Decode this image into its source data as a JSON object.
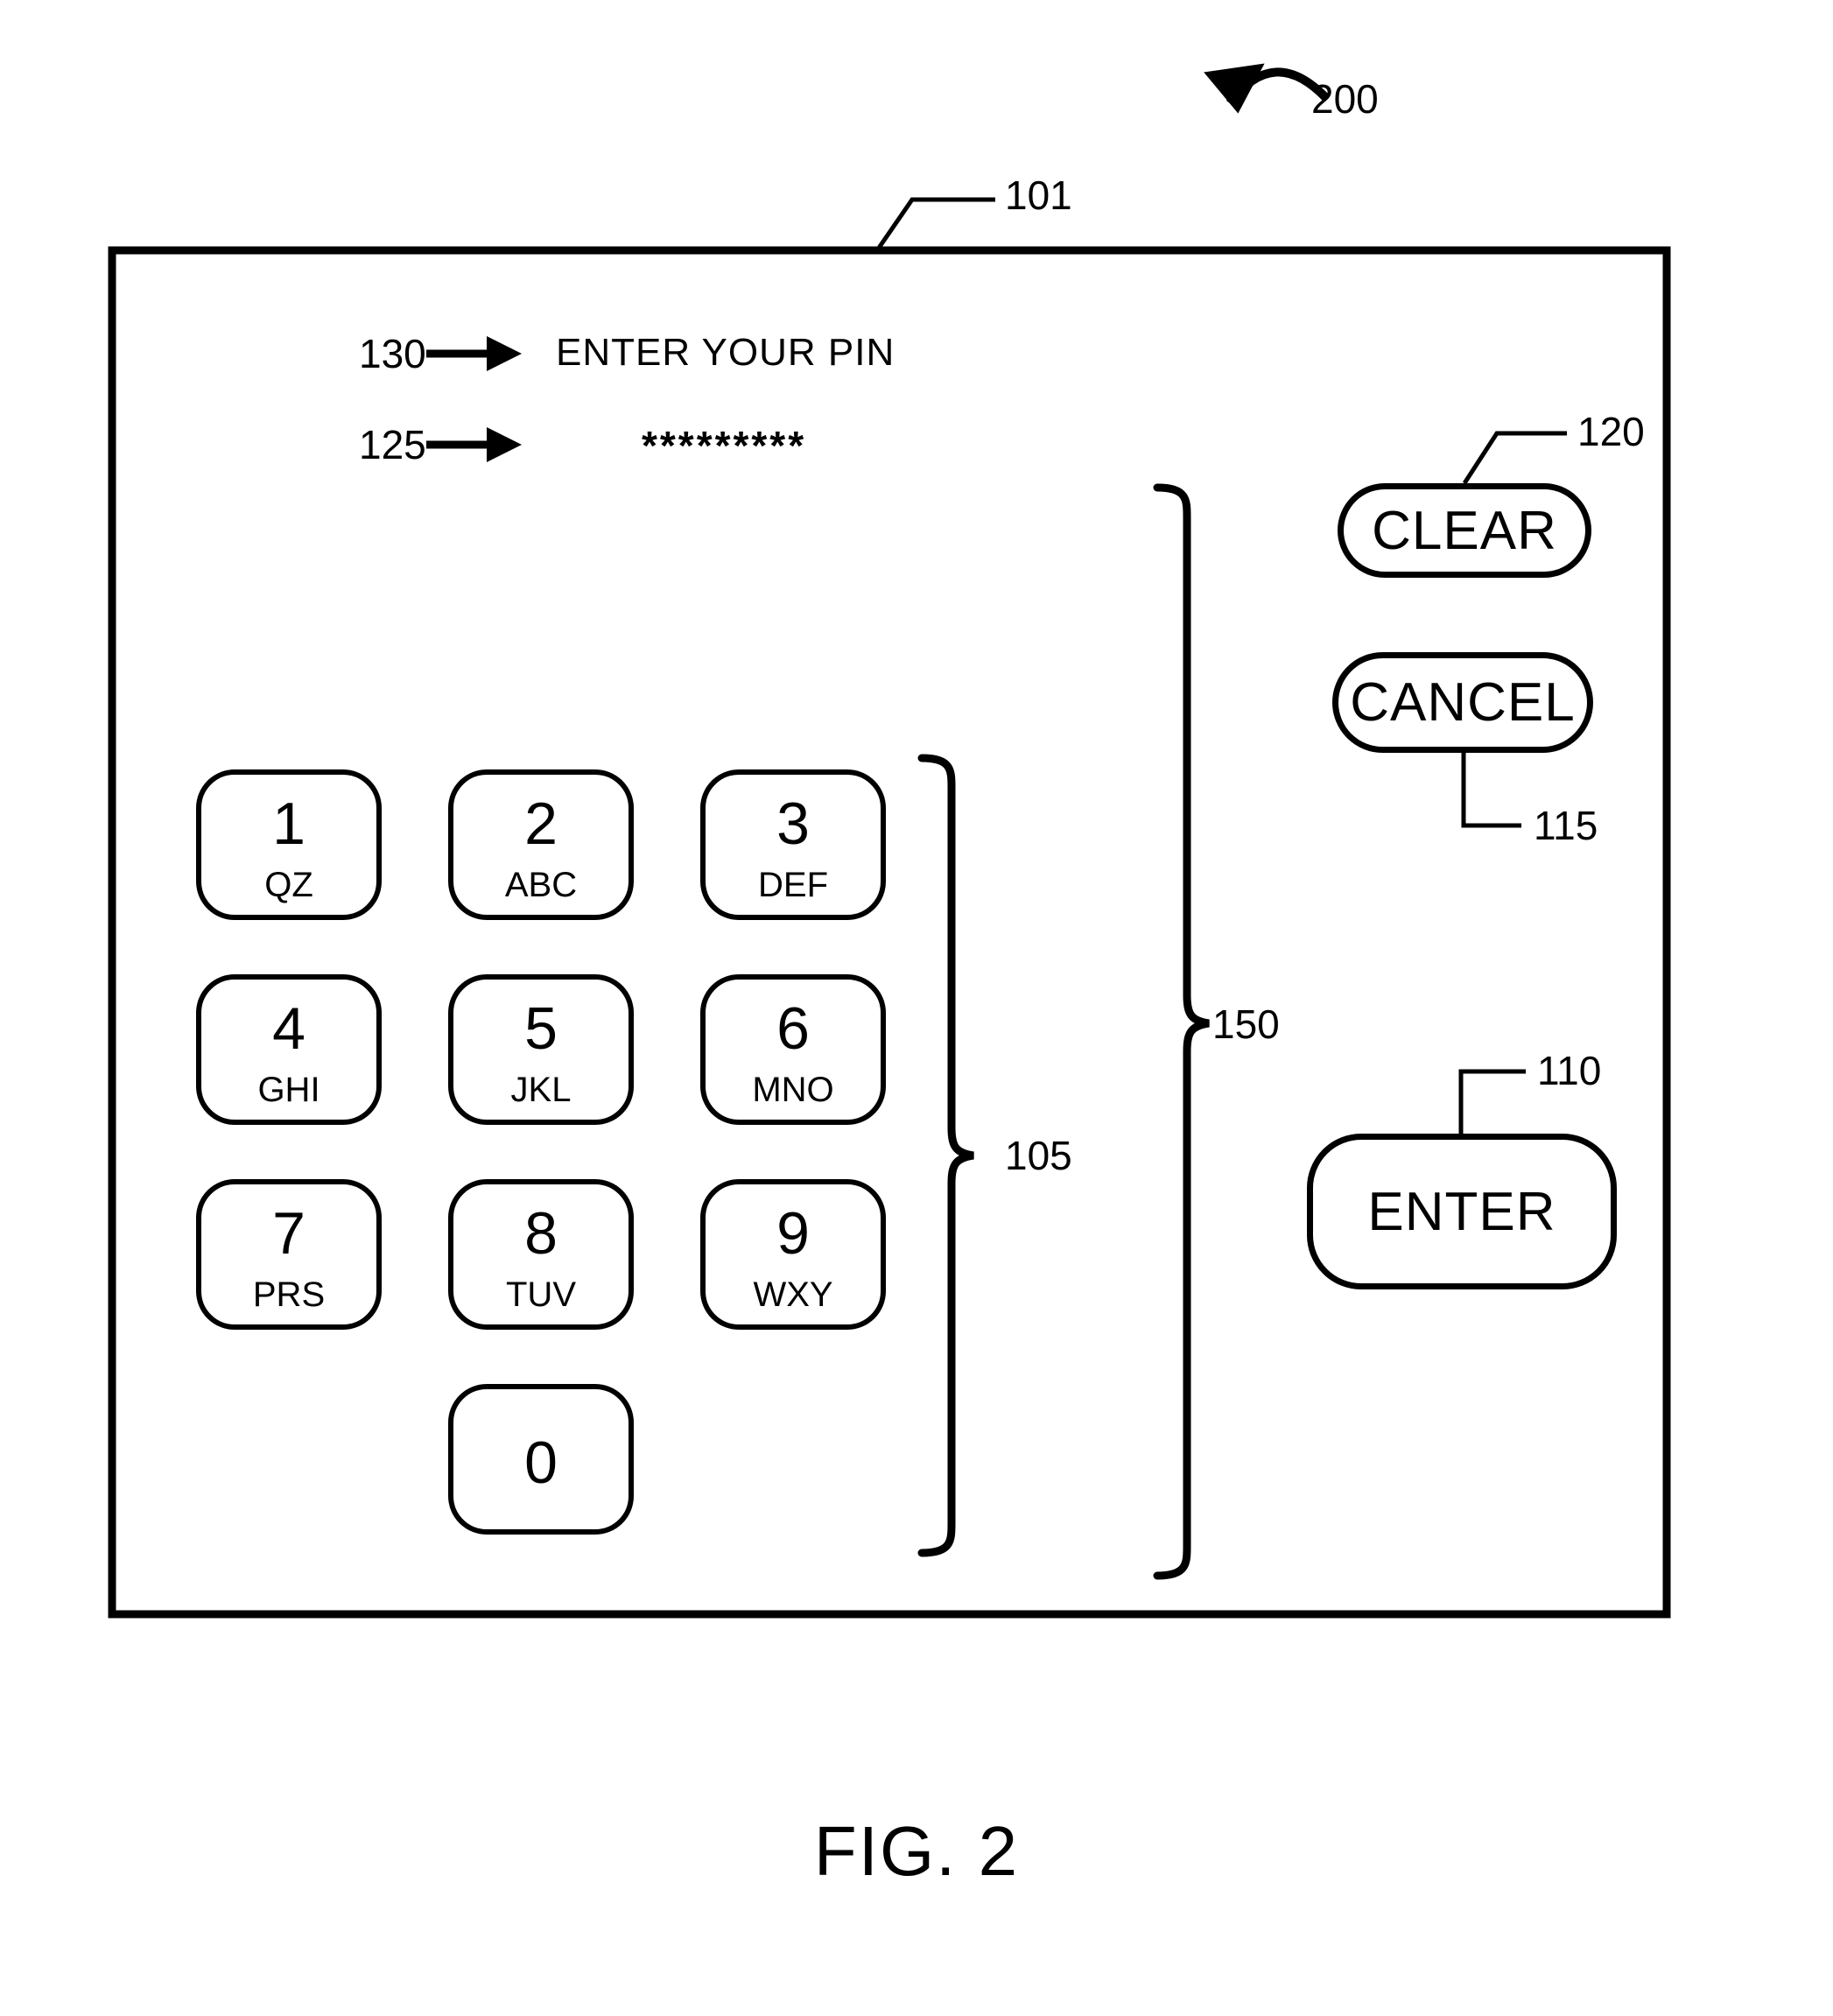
{
  "figure": {
    "caption": "FIG. 2",
    "figure_ref": "200",
    "device_ref": "101"
  },
  "screen": {
    "prompt_ref": "130",
    "prompt_text": "ENTER YOUR PIN",
    "pin_ref": "125",
    "pin_masked": "*********"
  },
  "keypad": {
    "ref": "105",
    "keys": [
      {
        "digit": "1",
        "letters": "QZ"
      },
      {
        "digit": "2",
        "letters": "ABC"
      },
      {
        "digit": "3",
        "letters": "DEF"
      },
      {
        "digit": "4",
        "letters": "GHI"
      },
      {
        "digit": "5",
        "letters": "JKL"
      },
      {
        "digit": "6",
        "letters": "MNO"
      },
      {
        "digit": "7",
        "letters": "PRS"
      },
      {
        "digit": "8",
        "letters": "TUV"
      },
      {
        "digit": "9",
        "letters": "WXY"
      },
      {
        "digit": "0",
        "letters": ""
      }
    ]
  },
  "controls": {
    "group_ref": "150",
    "clear": {
      "label": "CLEAR",
      "ref": "120"
    },
    "cancel": {
      "label": "CANCEL",
      "ref": "115"
    },
    "enter": {
      "label": "ENTER",
      "ref": "110"
    }
  },
  "colors": {
    "line": "#000000",
    "background": "#ffffff"
  }
}
